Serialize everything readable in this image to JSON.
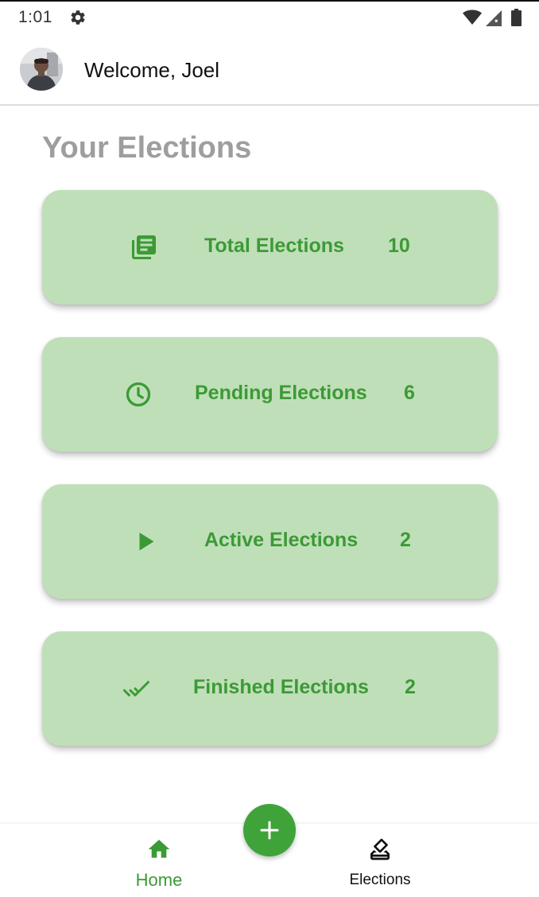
{
  "status_bar": {
    "time": "1:01",
    "icons": [
      "settings-gear-icon",
      "wifi-icon",
      "signal-icon",
      "battery-icon"
    ]
  },
  "app_bar": {
    "welcome_text": "Welcome, Joel"
  },
  "main": {
    "title": "Your Elections",
    "cards": [
      {
        "icon": "library-books-icon",
        "label": "Total Elections",
        "count": "10"
      },
      {
        "icon": "clock-icon",
        "label": "Pending Elections",
        "count": "6"
      },
      {
        "icon": "play-icon",
        "label": "Active Elections",
        "count": "2"
      },
      {
        "icon": "double-check-icon",
        "label": "Finished Elections",
        "count": "2"
      }
    ]
  },
  "bottom_nav": {
    "items": [
      {
        "icon": "home-icon",
        "label": "Home",
        "active": true
      },
      {
        "icon": "ballot-box-icon",
        "label": "Elections",
        "active": false
      }
    ],
    "fab_icon": "plus-icon"
  },
  "colors": {
    "accent_green": "#3c9a35",
    "card_background": "#bfdfb9",
    "title_gray": "#9e9e9e",
    "fab_green": "#3fa33a"
  }
}
